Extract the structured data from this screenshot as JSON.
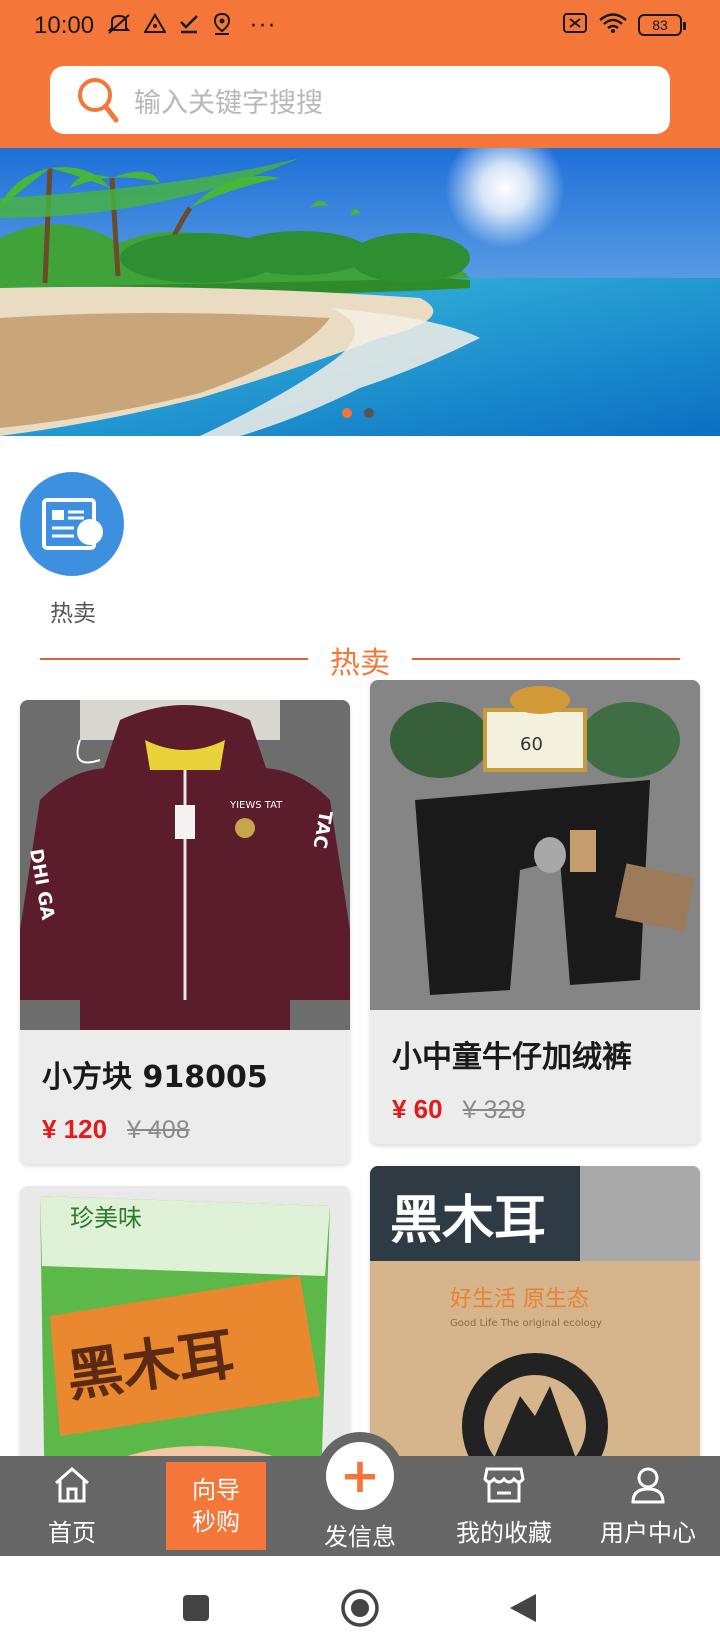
{
  "status_bar": {
    "time": "10:00",
    "left_icons": [
      "mute-icon",
      "alert-icon",
      "check-icon",
      "location-icon",
      "more-icon"
    ],
    "battery": "83"
  },
  "search": {
    "placeholder": "输入关键字搜搜"
  },
  "banner": {
    "slides": 2,
    "active_slide": 1
  },
  "categories": [
    {
      "label": "热卖",
      "icon": "news-list-icon",
      "color": "#3d8fe0"
    }
  ],
  "section": {
    "title": "热卖"
  },
  "products": [
    {
      "name": "小方块 918005",
      "price": "¥ 120",
      "old_price": "¥ 408",
      "image": "maroon-hoodie"
    },
    {
      "name": "小中童牛仔加绒裤",
      "price": "¥ 60",
      "old_price": "¥ 328",
      "image": "black-jeans"
    },
    {
      "name": "",
      "price": "",
      "old_price": "",
      "image": "black-fungus-bag"
    },
    {
      "name": "",
      "price": "",
      "old_price": "",
      "image": "black-fungus-box"
    }
  ],
  "product_box_text": {
    "brand_text": "黑木耳",
    "slogan": "好生活 原生态",
    "slogan_en": "Good Life  The original ecology"
  },
  "bottom_nav": {
    "home": "首页",
    "seckill_line1": "向导",
    "seckill_line2": "秒购",
    "post": "发信息",
    "favorites": "我的收藏",
    "user_center": "用户中心"
  },
  "colors": {
    "accent": "#f47638",
    "price": "#e31b1b",
    "nav_bg": "#666666",
    "category_icon": "#3d8fe0"
  }
}
